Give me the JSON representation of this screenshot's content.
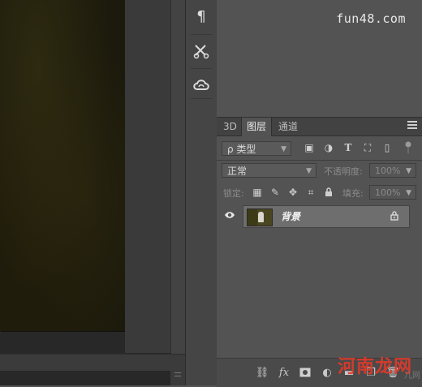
{
  "watermark_top": "fun48.com",
  "watermark_bottom": "河南龙网",
  "watermark_bottom_small": "儿网",
  "icon_strip": [
    {
      "name": "paragraph-icon",
      "glyph": "¶"
    },
    {
      "name": "tools-icon",
      "glyph": "✂"
    },
    {
      "name": "creative-cloud-icon",
      "glyph": "☁"
    }
  ],
  "layers_panel": {
    "tabs": [
      {
        "label": "3D",
        "active": false
      },
      {
        "label": "图层",
        "active": true
      },
      {
        "label": "通道",
        "active": false
      }
    ],
    "filter": {
      "kind_label": "ρ 类型"
    },
    "blend_mode": "正常",
    "opacity_label": "不透明度:",
    "opacity_value": "100%",
    "lock_label": "锁定:",
    "fill_label": "填充:",
    "fill_value": "100%",
    "layers": [
      {
        "name": "背景",
        "visible": true,
        "locked": true,
        "selected": true
      }
    ],
    "footer_icons": [
      "link-icon",
      "fx-icon",
      "mask-icon",
      "adjustment-icon",
      "folder-icon",
      "new-layer-icon",
      "trash-icon"
    ],
    "fx_label": "fx"
  },
  "colors": {
    "panel_bg": "#535353",
    "canvas_bg": "#282828",
    "selected_layer": "#6e6e6e",
    "watermark_red": "#e23a2a"
  }
}
